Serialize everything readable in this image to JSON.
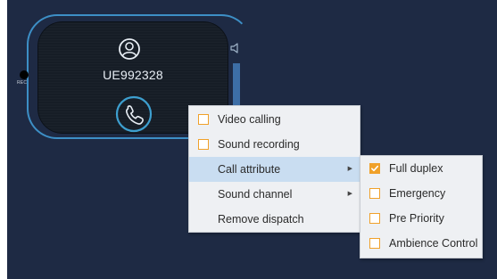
{
  "device": {
    "id": "UE992328",
    "rec_label": "REC",
    "icons": {
      "user": "user-circle-icon",
      "call": "phone-icon",
      "speaker": "speaker-icon"
    }
  },
  "context_menu": {
    "items": [
      {
        "label": "Video calling",
        "checkbox": true,
        "checked": false
      },
      {
        "label": "Sound recording",
        "checkbox": true,
        "checked": false
      },
      {
        "label": "Call attribute",
        "submenu": true,
        "highlighted": true
      },
      {
        "label": "Sound channel",
        "submenu": true
      },
      {
        "label": "Remove dispatch"
      }
    ]
  },
  "call_attribute_submenu": {
    "items": [
      {
        "label": "Full duplex",
        "checked": true
      },
      {
        "label": "Emergency",
        "checked": false
      },
      {
        "label": "Pre Priority",
        "checked": false
      },
      {
        "label": "Ambience Control",
        "checked": false
      }
    ]
  },
  "colors": {
    "background": "#1e2a44",
    "accent": "#3d8fc6",
    "checkbox": "#f0a12a",
    "highlight": "#c9ddf1"
  }
}
